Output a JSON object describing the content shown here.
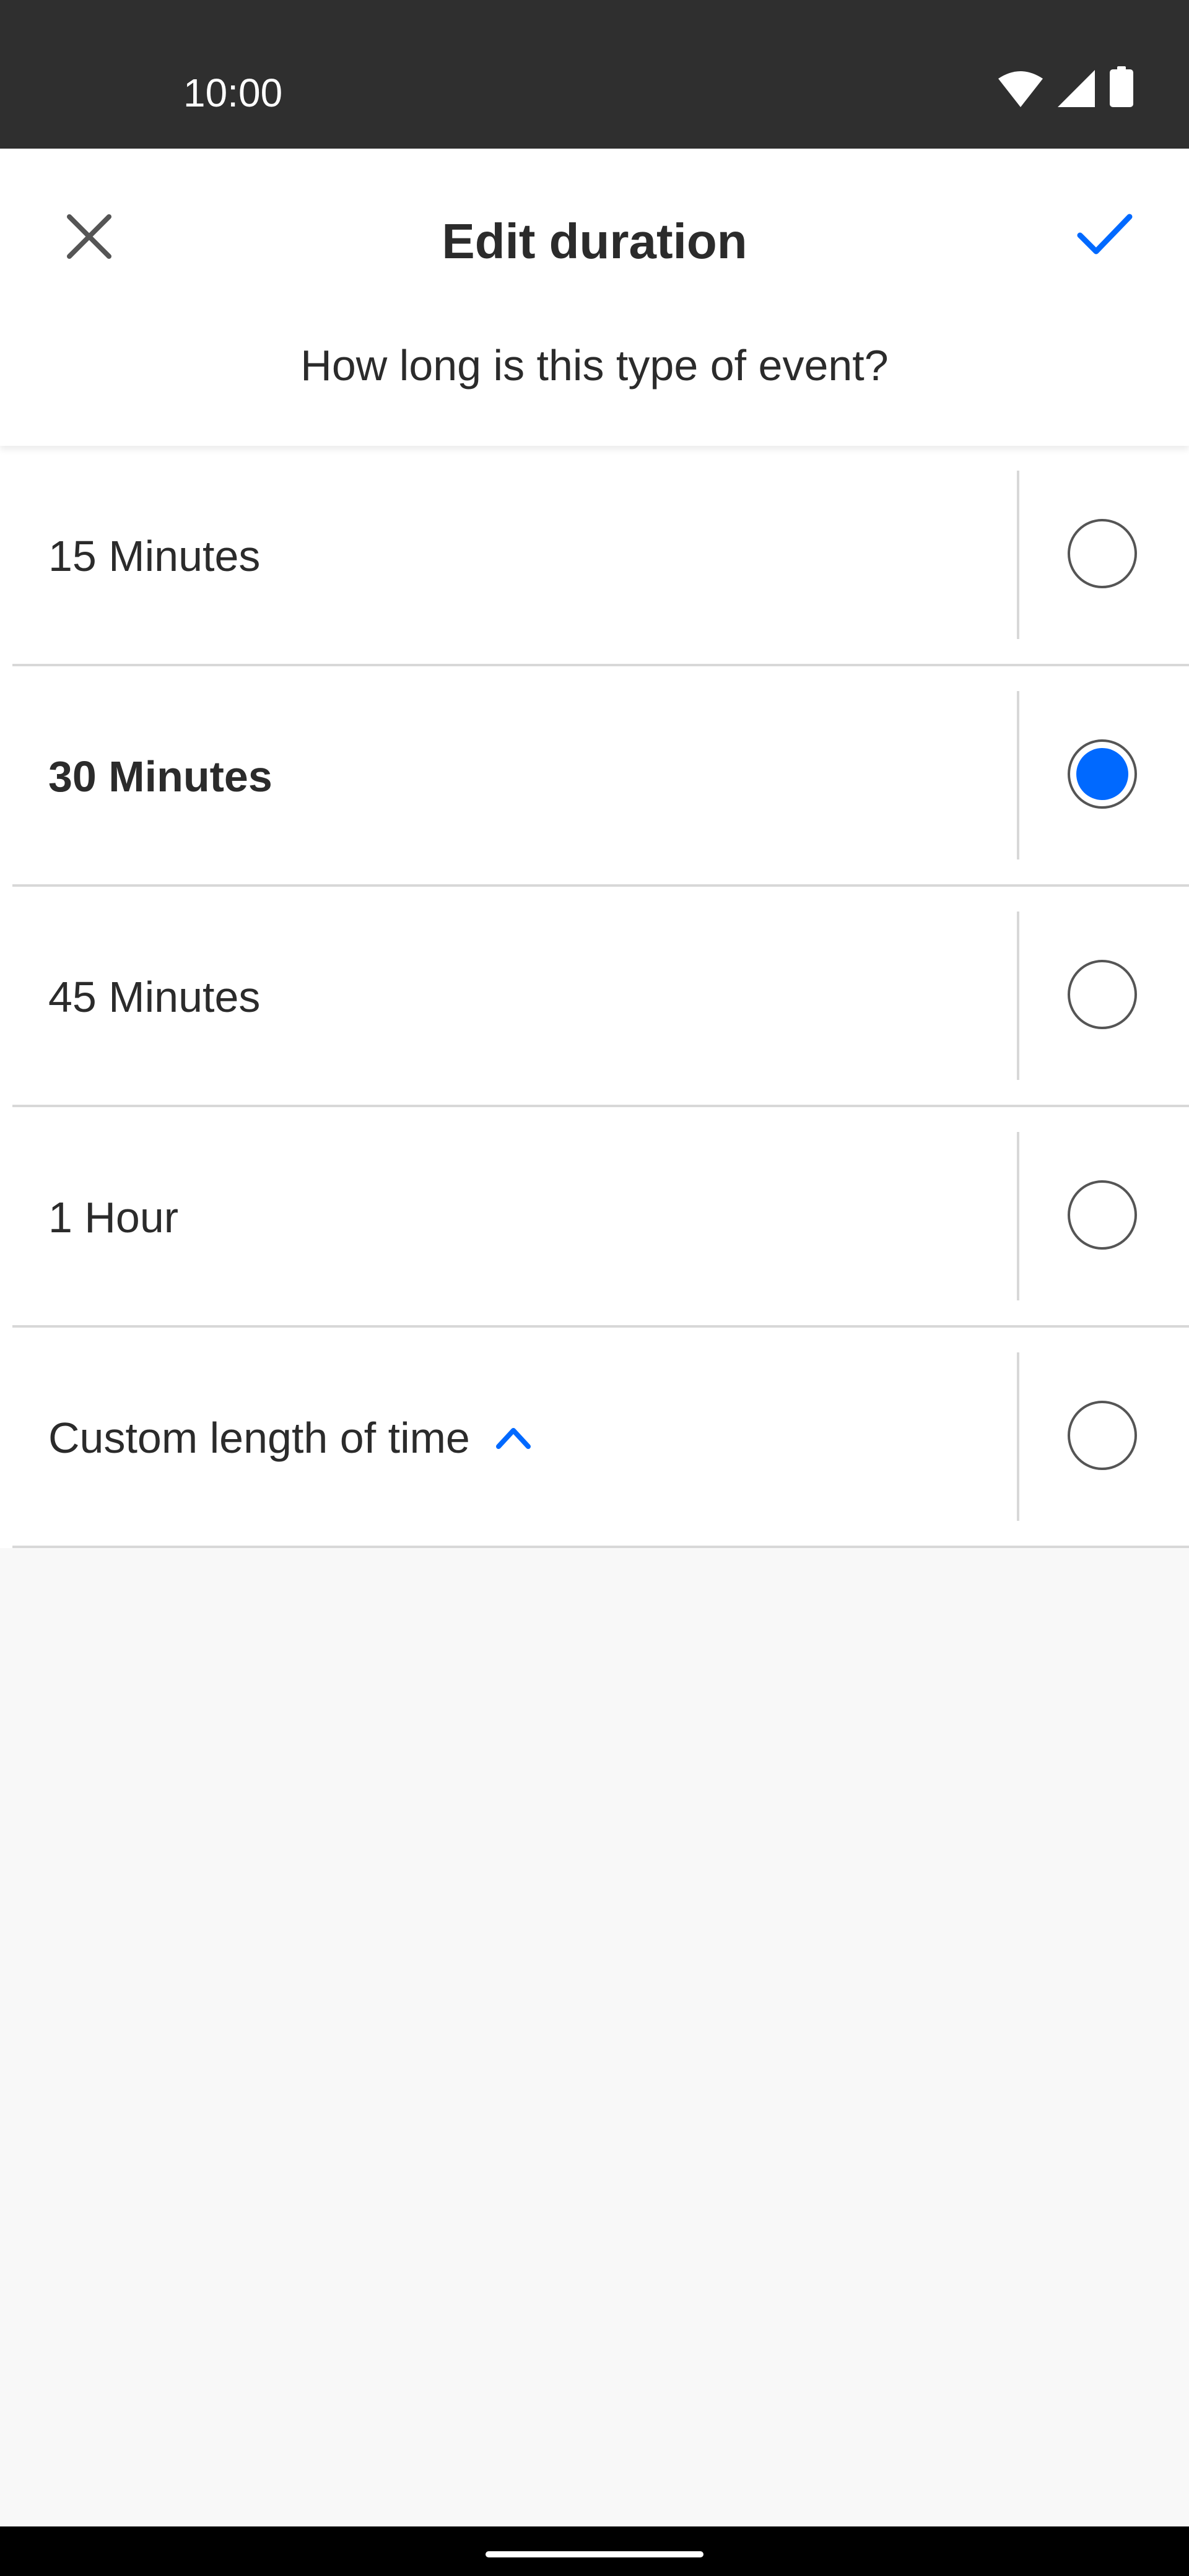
{
  "status_bar": {
    "time": "10:00",
    "icons": [
      "wifi-icon",
      "cellular-signal-icon",
      "battery-icon"
    ]
  },
  "header": {
    "title": "Edit duration",
    "subtitle": "How long is this type of event?",
    "close_icon": "close-icon",
    "confirm_icon": "check-icon"
  },
  "options": [
    {
      "label": "15 Minutes",
      "selected": false
    },
    {
      "label": "30 Minutes",
      "selected": true
    },
    {
      "label": "45 Minutes",
      "selected": false
    },
    {
      "label": "1 Hour",
      "selected": false
    },
    {
      "label": "Custom length of time",
      "selected": false,
      "icon": "chevron-up-icon"
    }
  ],
  "colors": {
    "accent": "#0069ff",
    "status_bar": "#2f2f2f",
    "text": "#2b2b2b",
    "background": "#f8f8f8"
  }
}
